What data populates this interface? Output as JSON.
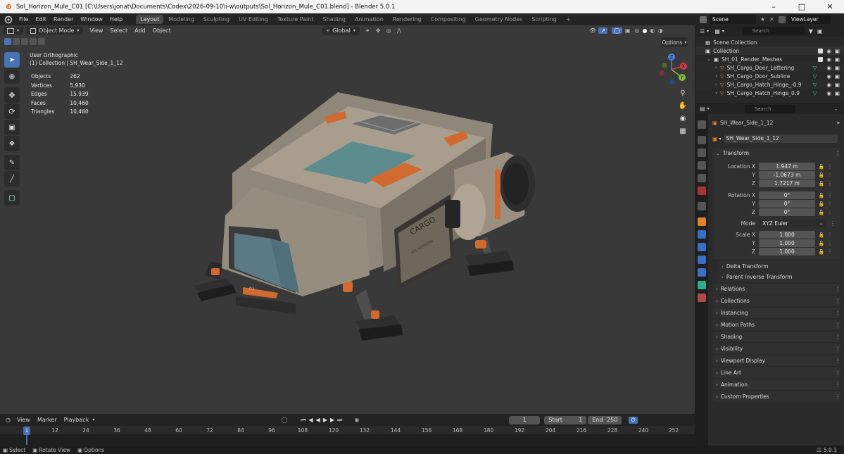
{
  "window": {
    "title": "Sol_Horizon_Mule_C01 [C:\\Users\\jonat\\Documents\\Codex\\2026-09-10\\i-w\\outputs\\Sol_Horizon_Mule_C01.blend] - Blender 5.0.1"
  },
  "menu": {
    "items": [
      "File",
      "Edit",
      "Render",
      "Window",
      "Help"
    ],
    "workspaces": [
      "Layout",
      "Modeling",
      "Sculpting",
      "UV Editing",
      "Texture Paint",
      "Shading",
      "Animation",
      "Rendering",
      "Compositing",
      "Geometry Nodes",
      "Scripting"
    ],
    "add_tab": "+"
  },
  "scene": {
    "scene_name": "Scene",
    "view_layer": "ViewLayer"
  },
  "viewport": {
    "mode": "Object Mode",
    "menus": [
      "View",
      "Select",
      "Add",
      "Object"
    ],
    "orientation": "Global",
    "options_label": "Options",
    "view_name": "User Orthographic",
    "context": "(1) Collection | SH_Wear_Side_1_12",
    "stats": [
      {
        "label": "Objects",
        "value": "262"
      },
      {
        "label": "Vertices",
        "value": "5,930"
      },
      {
        "label": "Edges",
        "value": "15,939"
      },
      {
        "label": "Faces",
        "value": "10,460"
      },
      {
        "label": "Triangles",
        "value": "10,460"
      }
    ],
    "gizmo": {
      "x": "X",
      "y": "Y",
      "z": "Z"
    },
    "model_labels": {
      "cargo": "CARGO",
      "sub": "SOL HORIZON",
      "num": "01"
    }
  },
  "outliner": {
    "search_placeholder": "Search",
    "rows": [
      {
        "label": "Scene Collection",
        "kind": "scene"
      },
      {
        "label": "Collection",
        "kind": "collection"
      },
      {
        "label": "SH_01_Render_Meshes",
        "kind": "collection"
      },
      {
        "label": "SH_Cargo_Door_Lettering",
        "kind": "mesh"
      },
      {
        "label": "SH_Cargo_Door_Subline",
        "kind": "mesh"
      },
      {
        "label": "SH_Cargo_Hatch_Hinge_-0.9",
        "kind": "mesh"
      },
      {
        "label": "SH_Cargo_Hatch_Hinge_0.9",
        "kind": "mesh"
      }
    ]
  },
  "properties": {
    "search_placeholder": "Search",
    "object_name": "SH_Wear_Side_1_12",
    "datablock_name": "SH_Wear_Side_1_12",
    "transform_label": "Transform",
    "location_label": "Location X",
    "rotation_label": "Rotation X",
    "scale_label": "Scale X",
    "y_label": "Y",
    "z_label": "Z",
    "location": [
      "1.947 m",
      "-1.0673 m",
      "1.7217 m"
    ],
    "rotation": [
      "0°",
      "0°",
      "0°"
    ],
    "mode_label": "Mode",
    "mode_value": "XYZ Euler",
    "scale": [
      "1.000",
      "1.000",
      "1.000"
    ],
    "sub_panels": [
      "Delta Transform",
      "Parent Inverse Transform"
    ],
    "panels": [
      "Relations",
      "Collections",
      "Instancing",
      "Motion Paths",
      "Shading",
      "Visibility",
      "Viewport Display",
      "Line Art",
      "Animation",
      "Custom Properties"
    ]
  },
  "timeline": {
    "menus": [
      "View",
      "Marker",
      "Playback"
    ],
    "current_frame": "1",
    "start_label": "Start",
    "start": "1",
    "end_label": "End",
    "end": "250",
    "ruler": [
      "1",
      "12",
      "24",
      "36",
      "48",
      "60",
      "72",
      "84",
      "96",
      "108",
      "120",
      "132",
      "144",
      "156",
      "168",
      "180",
      "192",
      "204",
      "216",
      "228",
      "240",
      "252"
    ]
  },
  "statusbar": {
    "items": [
      "Select",
      "Rotate View",
      "Options"
    ],
    "version": "5.0.1"
  },
  "colors": {
    "accent": "#4772b3",
    "orange": "#d06a2e",
    "hull": "#a99e8e",
    "teal": "#5d8c8e"
  }
}
